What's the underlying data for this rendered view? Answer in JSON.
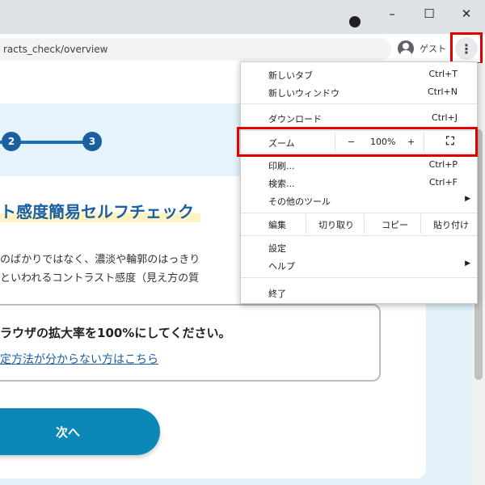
{
  "window": {
    "minimize": "–",
    "maximize": "☐",
    "close": "✕"
  },
  "toolbar": {
    "url": "racts_check/overview",
    "account_label": "ゲスト"
  },
  "page": {
    "steps": [
      "2",
      "3"
    ],
    "heading": "ト感度簡易セルフチェック",
    "desc_line1": "のばかりではなく、濃淡や輪郭のはっきり",
    "desc_line2": "といわれるコントラスト感度（見え方の質",
    "notice_text": "ラウザの拡大率を100%にしてください。",
    "notice_link": "定方法が分からない方はこちら",
    "next_button": "次へ"
  },
  "menu": {
    "new_tab": "新しいタブ",
    "new_tab_sc": "Ctrl+T",
    "new_window": "新しいウィンドウ",
    "new_window_sc": "Ctrl+N",
    "downloads": "ダウンロード",
    "downloads_sc": "Ctrl+J",
    "zoom_label": "ズーム",
    "zoom_minus": "−",
    "zoom_value": "100%",
    "zoom_plus": "+",
    "print": "印刷...",
    "print_sc": "Ctrl+P",
    "find": "検索...",
    "find_sc": "Ctrl+F",
    "more_tools": "その他のツール",
    "edit": "編集",
    "cut": "切り取り",
    "copy": "コピー",
    "paste": "貼り付け",
    "settings": "設定",
    "help": "ヘルプ",
    "exit": "終了"
  },
  "colors": {
    "highlight": "#e00000",
    "accent": "#1a5fa0",
    "button": "#0b88b8"
  }
}
